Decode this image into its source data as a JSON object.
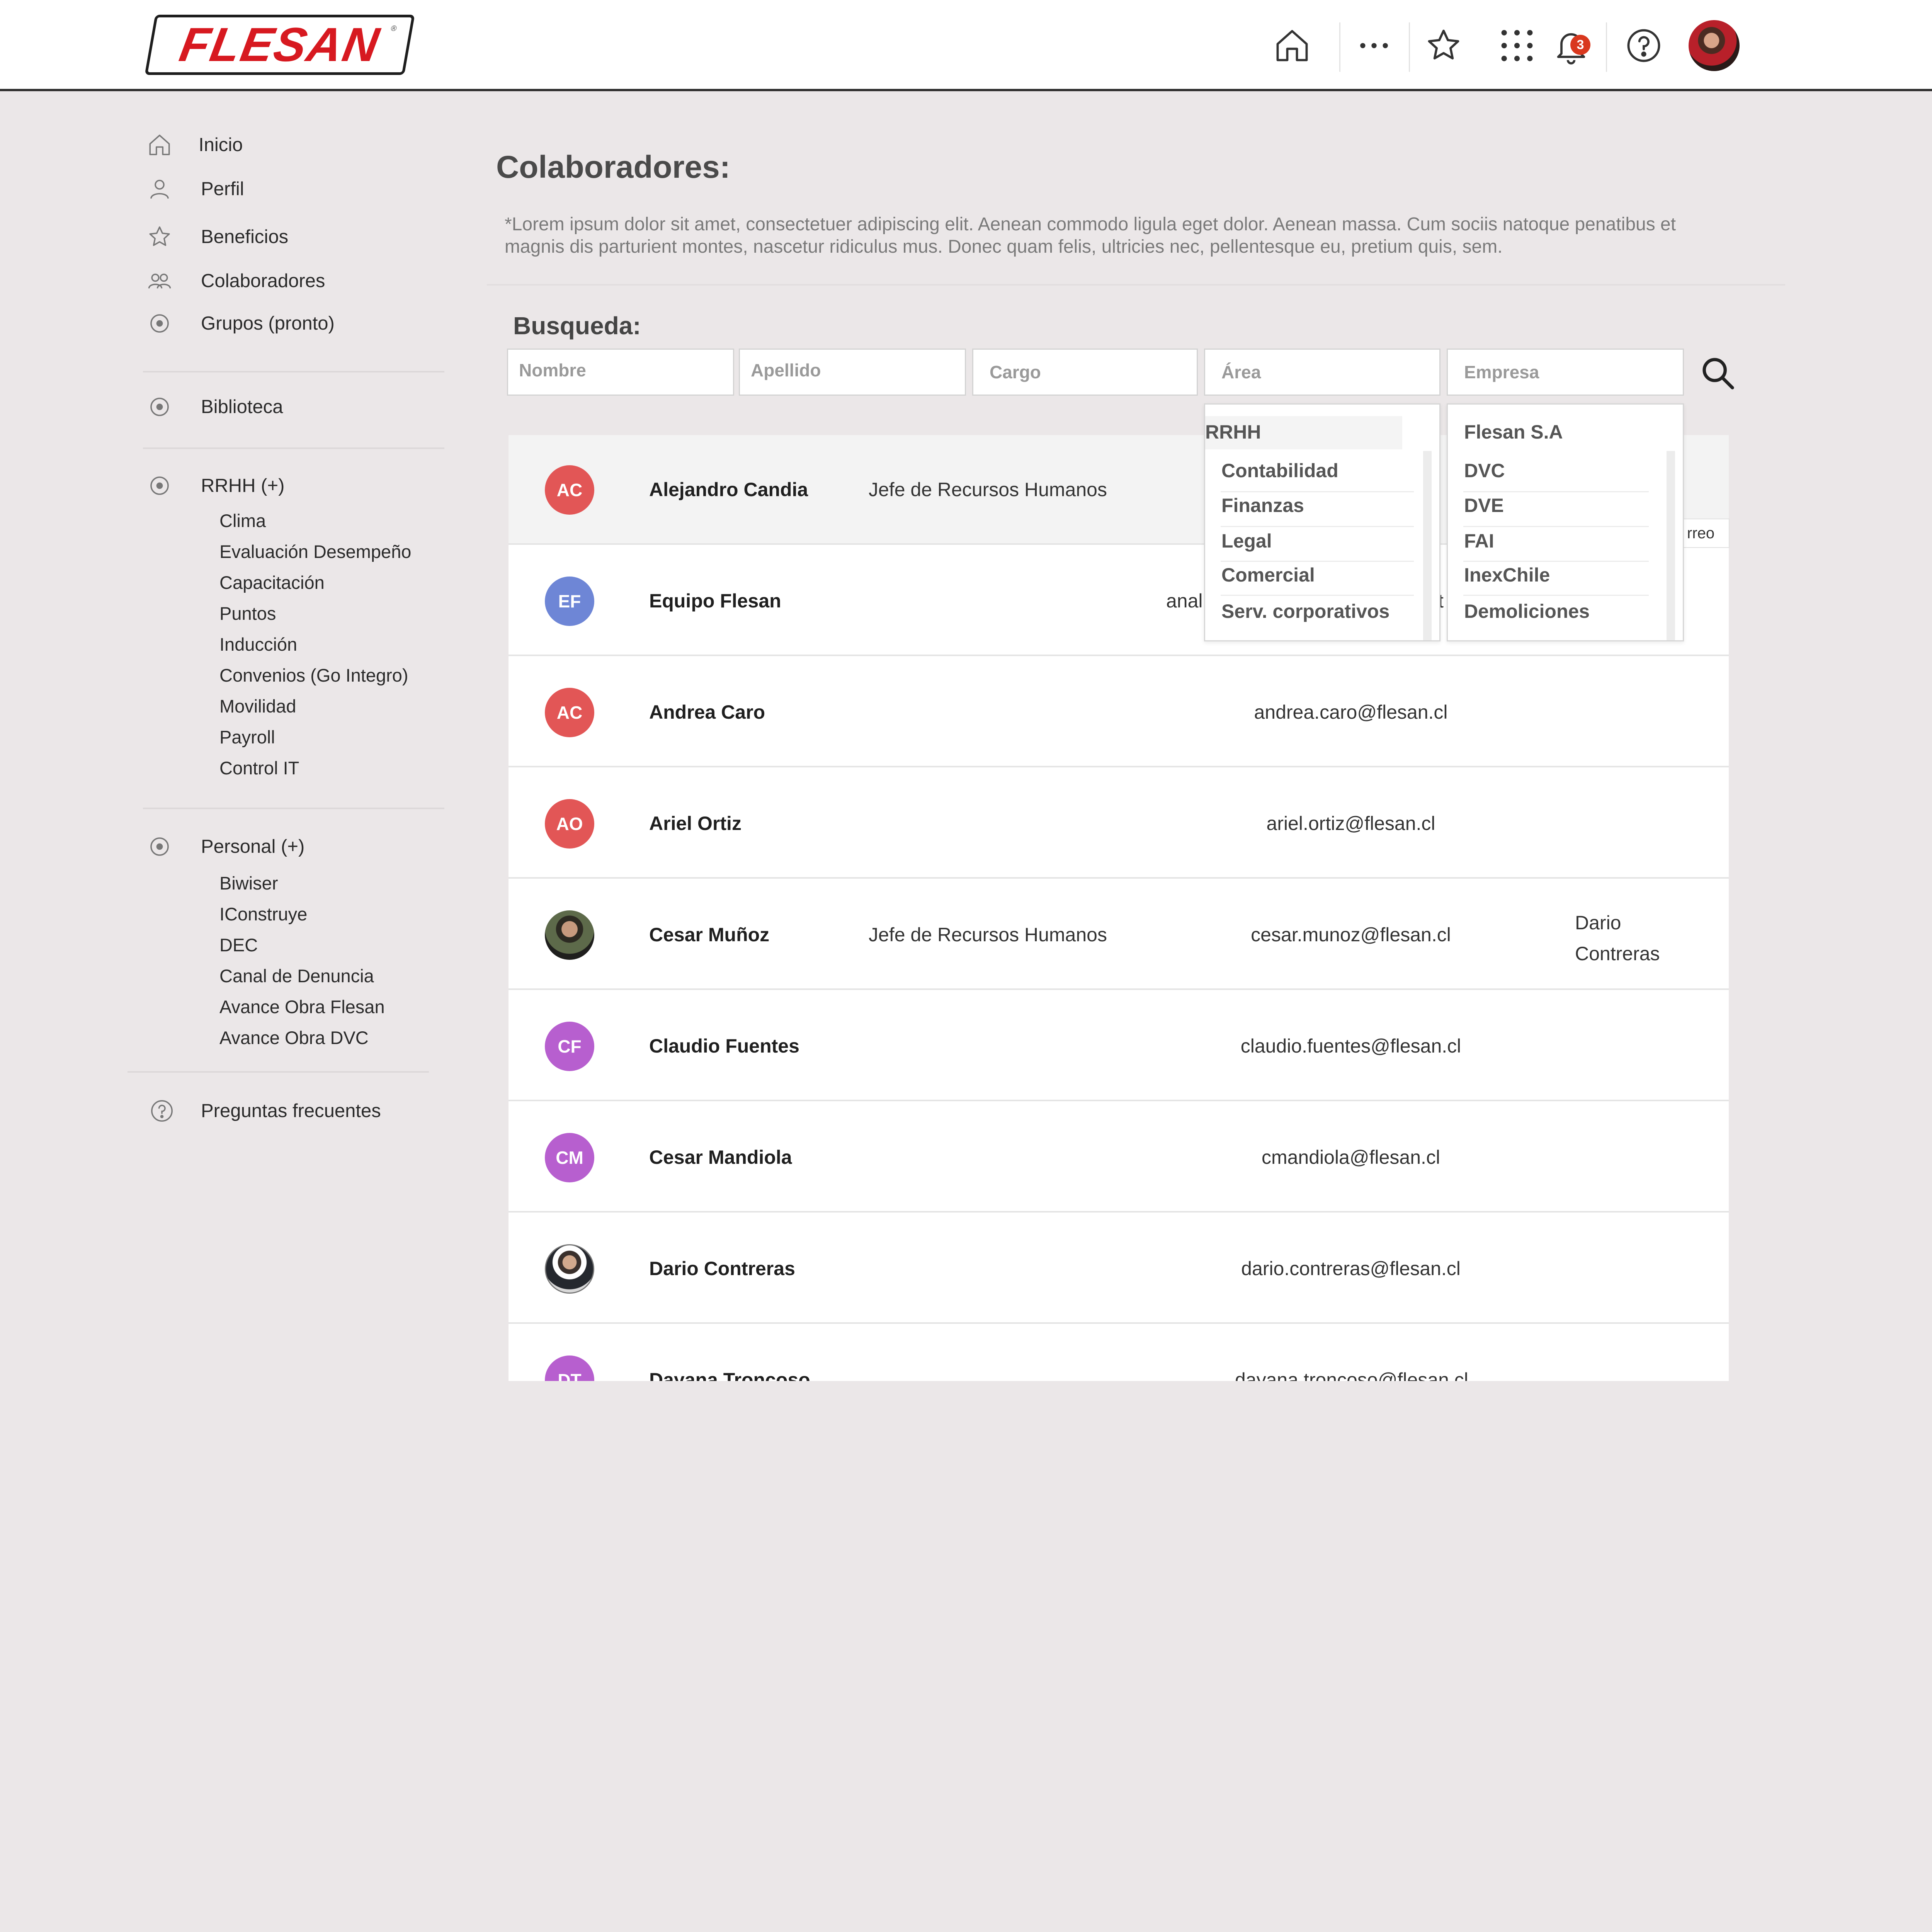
{
  "header": {
    "logo_text": "FLESAN",
    "logo_mark": "®",
    "icons": [
      "home-icon",
      "more-horizontal-icon",
      "star-icon",
      "apps-grid-icon",
      "bell-icon",
      "help-icon"
    ],
    "notification_count": "3"
  },
  "sidebar": {
    "items": [
      {
        "label": "Inicio",
        "icon": "home-icon"
      },
      {
        "label": "Perfil",
        "icon": "user-icon"
      },
      {
        "label": "Beneficios",
        "icon": "star-icon"
      },
      {
        "label": "Colaboradores",
        "icon": "users-icon"
      },
      {
        "label": "Grupos (pronto)",
        "icon": "radio-icon"
      },
      {
        "label": "Biblioteca",
        "icon": "radio-icon"
      },
      {
        "label": "RRHH (+)",
        "icon": "radio-icon"
      },
      {
        "label": "Personal (+)",
        "icon": "radio-icon"
      },
      {
        "label": "Preguntas frecuentes",
        "icon": "help-icon"
      }
    ],
    "rrhh_sub": [
      "Clima",
      "Evaluación Desempeño",
      "Capacitación",
      "Puntos",
      "Inducción",
      "Convenios (Go Integro)",
      "Movilidad",
      "Payroll",
      "Control IT"
    ],
    "personal_sub": [
      "Biwiser",
      "IConstruye",
      "DEC",
      "Canal de Denuncia",
      "Avance Obra Flesan",
      "Avance Obra DVC"
    ]
  },
  "main": {
    "title": "Colaboradores:",
    "intro": "*Lorem ipsum dolor sit amet, consectetuer adipiscing elit. Aenean commodo ligula eget dolor. Aenean massa. Cum sociis natoque penatibus et magnis dis parturient montes, nascetur ridiculus mus. Donec quam felis, ultricies nec, pellentesque eu, pretium quis, sem.",
    "search_label": "Busqueda:",
    "search": {
      "nombre": "Nombre",
      "apellido": "Apellido",
      "cargo": "Cargo",
      "area": "Área",
      "empresa": "Empresa"
    }
  },
  "area_dropdown": [
    "RRHH",
    "Contabilidad",
    "Finanzas",
    "Legal",
    "Comercial",
    "Serv. corporativos"
  ],
  "empresa_dropdown": [
    "Flesan S.A",
    "DVC",
    "DVE",
    "FAI",
    "InexChile",
    "Demoliciones"
  ],
  "fragments": {
    "anal": "anal",
    "t": "t",
    "correo": "rreo"
  },
  "rows": [
    {
      "initials": "AC",
      "color": "#e25656",
      "name": "Alejandro Candia",
      "cargo": "Jefe de Recursos Humanos",
      "email": "",
      "jefe": ""
    },
    {
      "initials": "EF",
      "color": "#6e86d6",
      "name": "Equipo Flesan",
      "cargo": "",
      "email": "",
      "jefe": ""
    },
    {
      "initials": "AC",
      "color": "#e25656",
      "name": "Andrea Caro",
      "cargo": "",
      "email": "andrea.caro@flesan.cl",
      "jefe": ""
    },
    {
      "initials": "AO",
      "color": "#e25656",
      "name": "Ariel Ortiz",
      "cargo": "",
      "email": "ariel.ortiz@flesan.cl",
      "jefe": ""
    },
    {
      "initials": "",
      "color": "",
      "name": "Cesar Muñoz",
      "cargo": "Jefe de Recursos Humanos",
      "email": "cesar.munoz@flesan.cl",
      "jefe": "Dario Contreras"
    },
    {
      "initials": "CF",
      "color": "#b75fcf",
      "name": "Claudio Fuentes",
      "cargo": "",
      "email": "claudio.fuentes@flesan.cl",
      "jefe": ""
    },
    {
      "initials": "CM",
      "color": "#b75fcf",
      "name": "Cesar Mandiola",
      "cargo": "",
      "email": "cmandiola@flesan.cl",
      "jefe": ""
    },
    {
      "initials": "",
      "color": "",
      "name": "Dario Contreras",
      "cargo": "",
      "email": "dario.contreras@flesan.cl",
      "jefe": ""
    },
    {
      "initials": "DT",
      "color": "#b75fcf",
      "name": "Dayana Troncoso",
      "cargo": "",
      "email": "dayana.troncoso@flesan.cl",
      "jefe": ""
    }
  ]
}
